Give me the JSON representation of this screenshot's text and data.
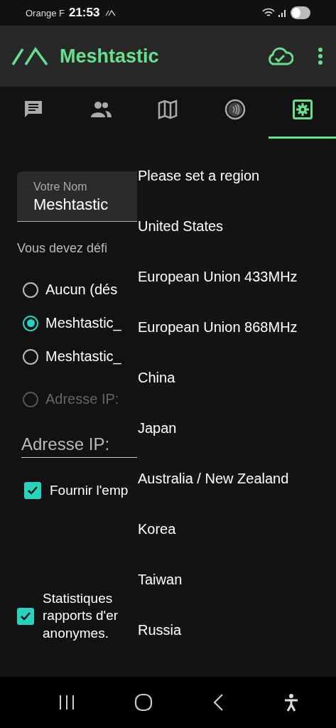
{
  "status_bar": {
    "carrier": "Orange F",
    "time": "21:53"
  },
  "app_bar": {
    "title": "Meshtastic"
  },
  "tabs": [
    {
      "kind": "messages",
      "selected": false
    },
    {
      "kind": "contacts",
      "selected": false
    },
    {
      "kind": "map",
      "selected": false
    },
    {
      "kind": "channel",
      "selected": false
    },
    {
      "kind": "settings",
      "selected": true
    }
  ],
  "settings": {
    "name_field": {
      "label": "Votre Nom",
      "value": "Meshtastic"
    },
    "hint": "Vous devez défi",
    "radios": [
      {
        "label": "Aucun (dés",
        "selected": false,
        "disabled": false
      },
      {
        "label": "Meshtastic_",
        "selected": true,
        "disabled": false
      },
      {
        "label": "Meshtastic_",
        "selected": false,
        "disabled": false
      },
      {
        "label": "Adresse IP:",
        "selected": false,
        "disabled": true
      }
    ],
    "ip_field": {
      "placeholder": "Adresse IP:"
    },
    "checkboxes": [
      {
        "label": "Fournir l'emp",
        "checked": true
      },
      {
        "label": "Statistiques\nrapports d'er\nanonymes.",
        "checked": true
      }
    ]
  },
  "region_menu": {
    "items": [
      "Please set a region",
      "United States",
      "European Union 433MHz",
      "European Union 868MHz",
      "China",
      "Japan",
      "Australia / New Zealand",
      "Korea",
      "Taiwan",
      "Russia"
    ]
  }
}
